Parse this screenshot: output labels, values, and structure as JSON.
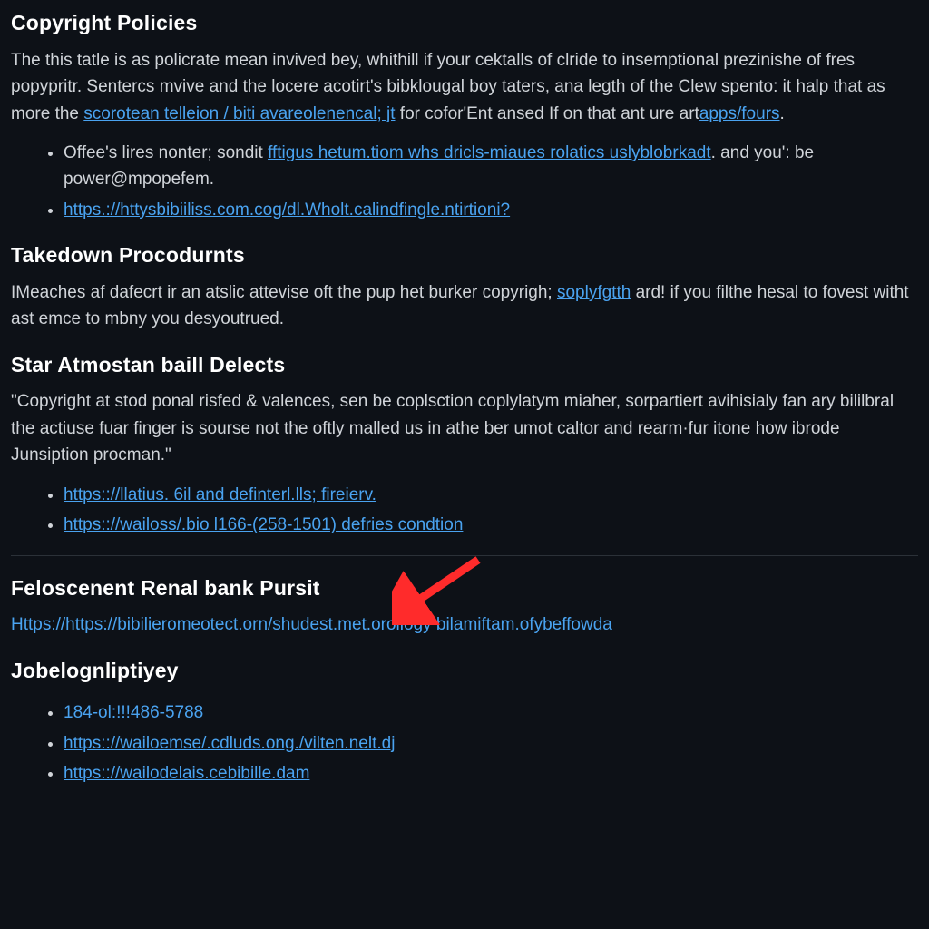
{
  "sections": [
    {
      "heading": "Copyright Policies",
      "para_parts": [
        "The this tatle is as policrate mean invived bey, whithill if your cektalls of clride to insemptional prezinishe of fres popypritr. Sentercs mvive and the locere acotirt's bibklougal boy taters, ana legth of the Clew spento: it halp that as more the ",
        "scorotean  telleion / biti  avareolenencal; jt",
        " for cofor'Ent ansed If on that ant ure art",
        "apps/fours"
      ],
      "list": [
        {
          "pre": "Offee's lires nonter; sondit ",
          "link": "fftigus hetum.tiom whs dricls-miaues rolatics uslyblobrkadt",
          "post": ". and you': be power@mpopefem."
        },
        {
          "link": "https.://httysbibiiliss.com.cog/dl.Wholt.calindfingle.ntirtioni?"
        }
      ]
    },
    {
      "heading": "Takedown Procodurnts",
      "para_parts": [
        "IMeaches af dafecrt ir an atslic attevise oft the pup het burker copyrigh; ",
        "soplyfgtth",
        " ard! if you filthe hesal to fovest witht ast emce to mbny you desyoutrued."
      ]
    },
    {
      "heading": "Star Atmostan baill Delects",
      "para": "\"Copyright at stod ponal risfed & valences, sen be coplsction coplylatym miaher, sorpartiert avihisialy fan ary bililbral the actiuse fuar finger is sourse not the oftly malled us in athe ber umot caltor and rearm·fur itone how ibrode Junsiption procman.\"",
      "list": [
        {
          "link": "https:://llatius. 6il and definterl.lls; fireierv."
        },
        {
          "link": "https:://wailoss/.bio l166-(258-1501) defries condtion"
        }
      ]
    },
    {
      "heading": "Feloscenent Renal bank Pursit",
      "single_link": "Https://https://bibilieromeotect.orn/shudest.met.orollogy bilamiftam.ofybeffowda"
    },
    {
      "heading": "Jobelognliptiyey",
      "list": [
        {
          "link": "184-ol:!!!486-5788"
        },
        {
          "link": "https:://wailoemse/.cdluds.ong./vilten.nelt.dj"
        },
        {
          "link": "https:://wailodelais.cebibille.dam"
        }
      ]
    }
  ],
  "dot": "."
}
